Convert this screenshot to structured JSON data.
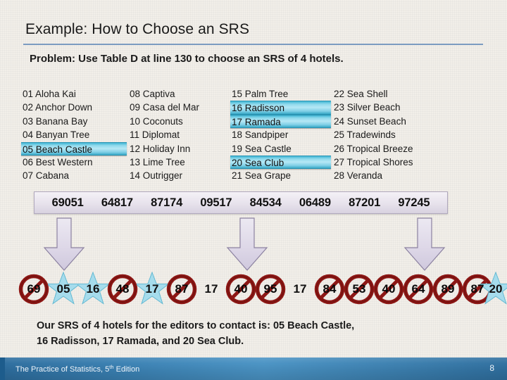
{
  "slide": {
    "title": "Example: How to Choose an SRS",
    "problem": "Problem: Use Table D at line 130 to choose an SRS of 4 hotels.",
    "conclusion_line1": "Our SRS of 4 hotels for the editors to contact is: 05 Beach Castle,",
    "conclusion_line2": "16 Radisson, 17 Ramada, and 20 Sea Club."
  },
  "colors": {
    "title_rule": "#7b9bc0",
    "highlight": "#8fd9ec",
    "star": "#9fd9ea",
    "reject_ring": "#8e1a18",
    "arrow": "#dcd7e6",
    "footer": "#3b82b4",
    "background": "#f2efe9"
  },
  "hotel_columns": [
    {
      "items": [
        {
          "number": "01",
          "name": "Aloha Kai",
          "selected": false
        },
        {
          "number": "02",
          "name": "Anchor Down",
          "selected": false
        },
        {
          "number": "03",
          "name": "Banana Bay",
          "selected": false
        },
        {
          "number": "04",
          "name": "Banyan Tree",
          "selected": false
        },
        {
          "number": "05",
          "name": "Beach Castle",
          "selected": true
        },
        {
          "number": "06",
          "name": "Best Western",
          "selected": false
        },
        {
          "number": "07",
          "name": "Cabana",
          "selected": false
        }
      ]
    },
    {
      "items": [
        {
          "number": "08",
          "name": "Captiva",
          "selected": false
        },
        {
          "number": "09",
          "name": "Casa del Mar",
          "selected": false
        },
        {
          "number": "10",
          "name": "Coconuts",
          "selected": false
        },
        {
          "number": "11",
          "name": "Diplomat",
          "selected": false
        },
        {
          "number": "12",
          "name": "Holiday Inn",
          "selected": false
        },
        {
          "number": "13",
          "name": "Lime Tree",
          "selected": false
        },
        {
          "number": "14",
          "name": "Outrigger",
          "selected": false
        }
      ]
    },
    {
      "items": [
        {
          "number": "15",
          "name": "Palm Tree",
          "selected": false
        },
        {
          "number": "16",
          "name": "Radisson",
          "selected": true
        },
        {
          "number": "17",
          "name": "Ramada",
          "selected": true
        },
        {
          "number": "18",
          "name": "Sandpiper",
          "selected": false
        },
        {
          "number": "19",
          "name": "Sea Castle",
          "selected": false
        },
        {
          "number": "20",
          "name": "Sea Club",
          "selected": true
        },
        {
          "number": "21",
          "name": "Sea Grape",
          "selected": false
        }
      ]
    },
    {
      "items": [
        {
          "number": "22",
          "name": "Sea Shell",
          "selected": false
        },
        {
          "number": "23",
          "name": "Silver Beach",
          "selected": false
        },
        {
          "number": "24",
          "name": "Sunset Beach",
          "selected": false
        },
        {
          "number": "25",
          "name": "Tradewinds",
          "selected": false
        },
        {
          "number": "26",
          "name": "Tropical Breeze",
          "selected": false
        },
        {
          "number": "27",
          "name": "Tropical Shores",
          "selected": false
        },
        {
          "number": "28",
          "name": "Veranda",
          "selected": false
        }
      ]
    }
  ],
  "random_digits": [
    "69051",
    "64817",
    "87174",
    "09517",
    "84534",
    "06489",
    "87201",
    "97245"
  ],
  "result_tokens": [
    {
      "value": "69",
      "state": "rejected"
    },
    {
      "value": "05",
      "state": "accepted"
    },
    {
      "value": "16",
      "state": "accepted"
    },
    {
      "value": "48",
      "state": "rejected"
    },
    {
      "value": "17",
      "state": "accepted"
    },
    {
      "value": "87",
      "state": "rejected"
    },
    {
      "value": "17",
      "state": "plain"
    },
    {
      "value": "40",
      "state": "rejected"
    },
    {
      "value": "95",
      "state": "rejected"
    },
    {
      "value": "17",
      "state": "plain"
    },
    {
      "value": "84",
      "state": "rejected"
    },
    {
      "value": "53",
      "state": "rejected"
    },
    {
      "value": "40",
      "state": "rejected"
    },
    {
      "value": "64",
      "state": "rejected"
    },
    {
      "value": "89",
      "state": "rejected"
    },
    {
      "value": "87",
      "state": "rejected"
    },
    {
      "value": "20",
      "state": "accepted"
    }
  ],
  "arrows": [
    {
      "name": "arrow-down-1"
    },
    {
      "name": "arrow-down-2"
    },
    {
      "name": "arrow-down-3"
    }
  ],
  "footer": {
    "title_main": "The Practice of Statistics, 5",
    "title_sup": "th",
    "title_tail": " Edition",
    "page": "8"
  }
}
